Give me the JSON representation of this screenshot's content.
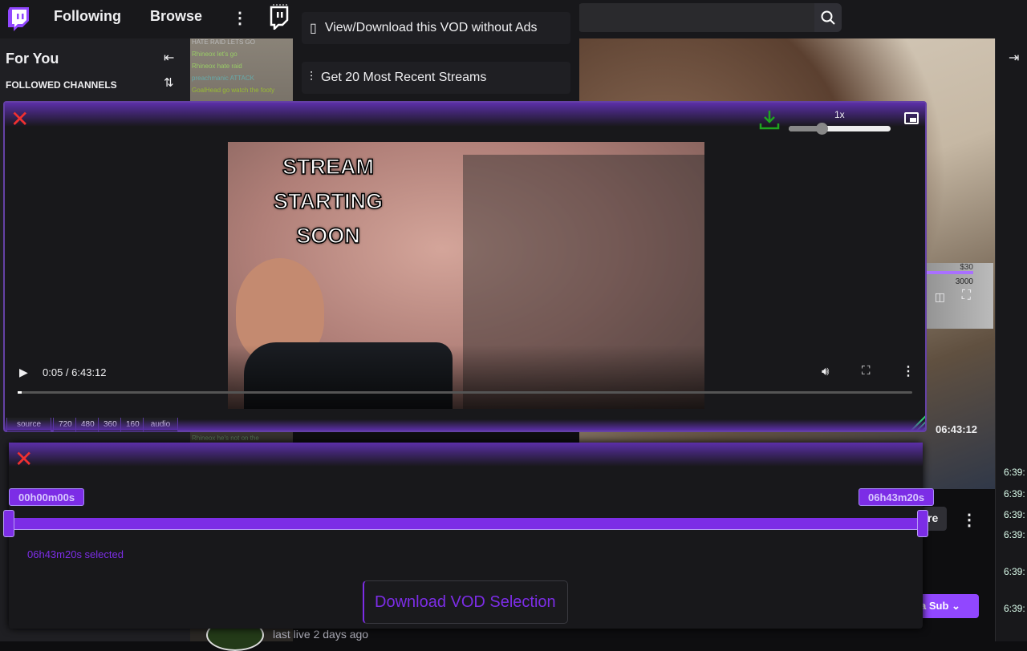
{
  "nav": {
    "following": "Following",
    "browse": "Browse",
    "more_icon": "more-vertical-icon",
    "search_icon": "search-icon"
  },
  "dropdown": {
    "items": [
      {
        "label": "View/Download this VOD without Ads",
        "icon": "vod-icon"
      },
      {
        "label": "Get 20 Most Recent Streams",
        "icon": "sliders-icon"
      }
    ]
  },
  "sidebar": {
    "title": "For You",
    "section": "FOLLOWED CHANNELS"
  },
  "chat": {
    "lines": [
      "HATE RAID LETS GO",
      "Rhineox  let's go",
      "Rhineox  hate raid",
      "preachmanic  ATTACK",
      "GoalHead  go watch the footy",
      "Rhineox  he's not on the"
    ]
  },
  "player": {
    "speed": "1x",
    "speed_value": 1,
    "time": "0:05 / 6:43:12",
    "progress_fraction": 0.0002,
    "qualities": [
      "source",
      "720",
      "480",
      "360",
      "160",
      "audio"
    ],
    "video_text": [
      "STREAM",
      "STARTING",
      "SOON"
    ]
  },
  "background": {
    "duration": "06:43:12",
    "sub_button": "a Sub",
    "share_partial": "re",
    "last_live": "last live 2 days ago",
    "goal_amount": "$30",
    "goal_count": "3000",
    "chat_times": [
      "6:39:",
      "6:39:",
      "6:39:",
      "6:39:",
      "6:39:",
      "6:39:"
    ]
  },
  "clipper": {
    "start_label": "00h00m00s",
    "end_label": "06h43m20s",
    "selected": "06h43m20s selected",
    "download": "Download VOD Selection",
    "range_start_fraction": 0,
    "range_end_fraction": 1
  },
  "colors": {
    "accent": "#772ce8",
    "close": "#f03030",
    "download": "#1fa51f"
  }
}
